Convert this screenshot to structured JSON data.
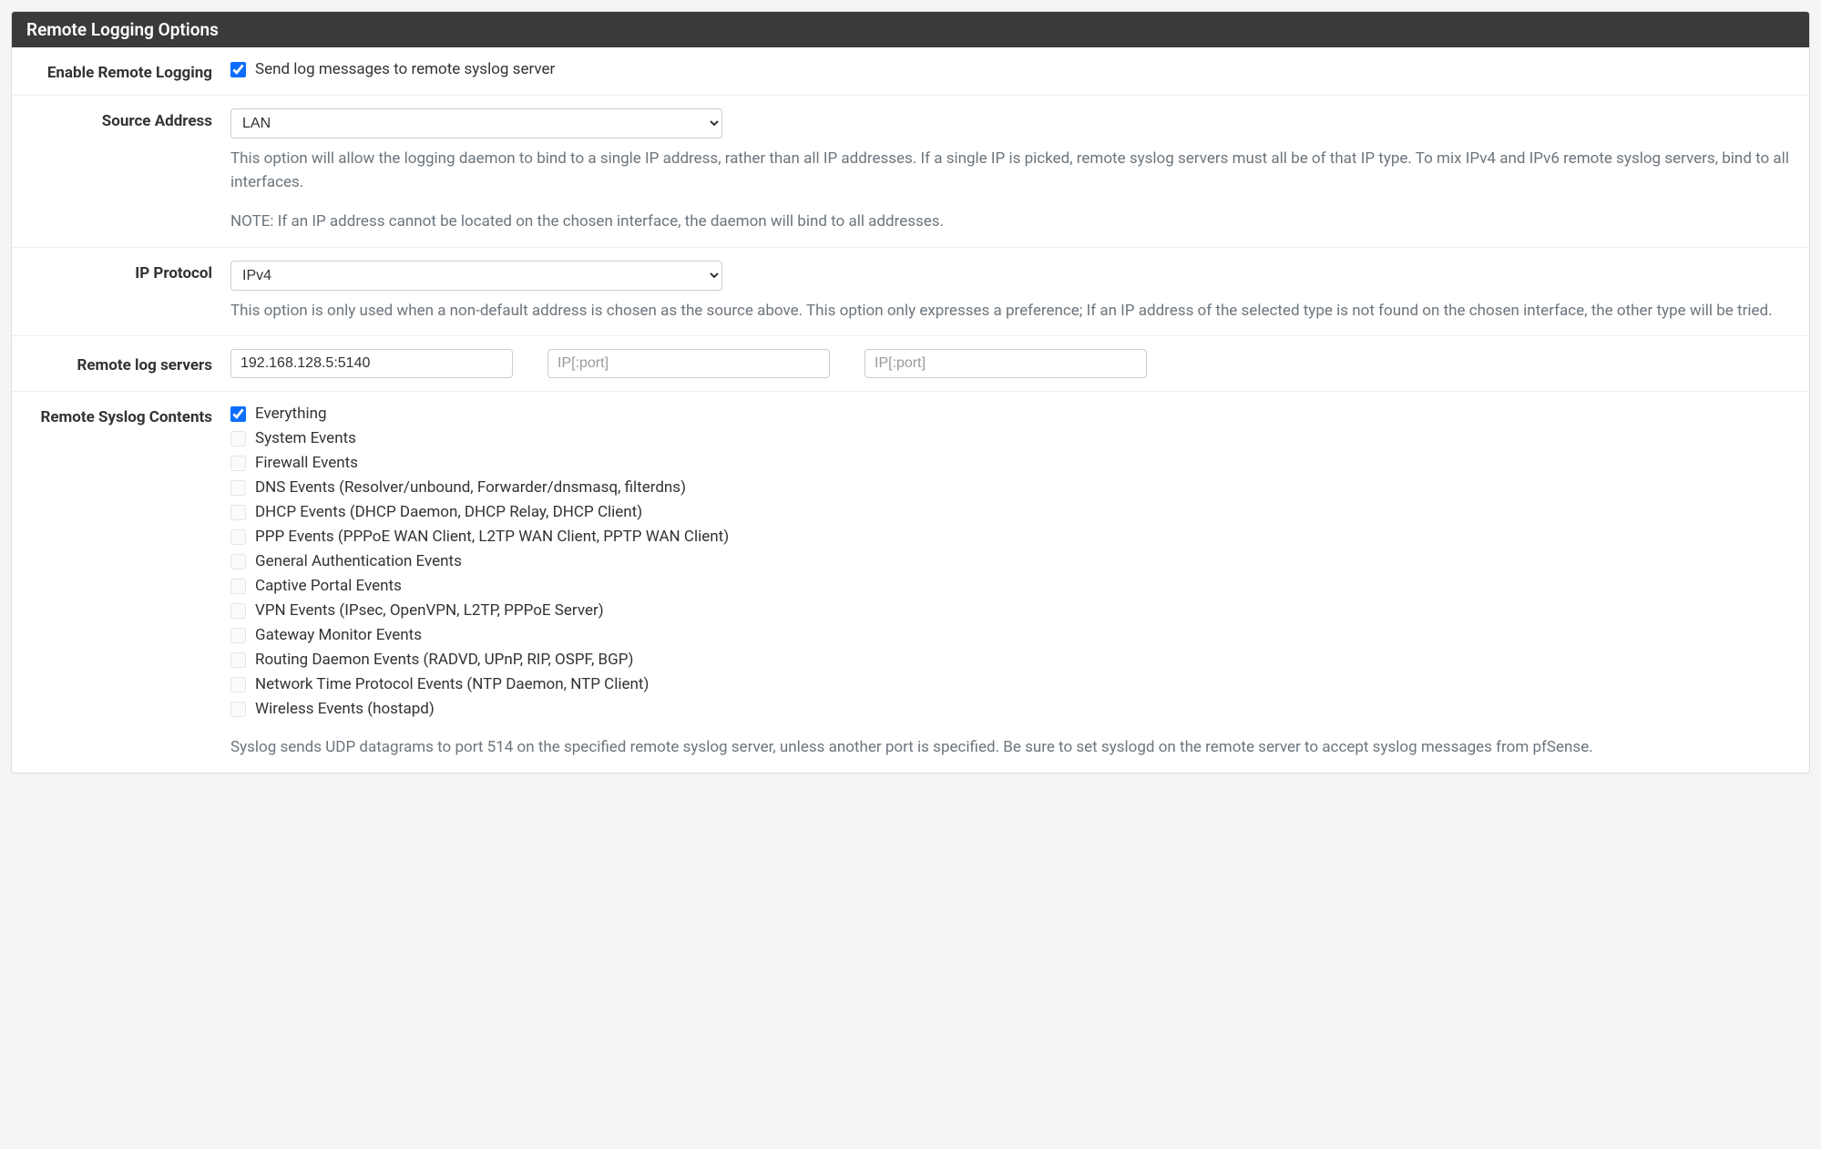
{
  "panel": {
    "title": "Remote Logging Options"
  },
  "enableRemote": {
    "label": "Enable Remote Logging",
    "checkboxLabel": "Send log messages to remote syslog server",
    "checked": true
  },
  "sourceAddress": {
    "label": "Source Address",
    "selected": "LAN",
    "help1": "This option will allow the logging daemon to bind to a single IP address, rather than all IP addresses. If a single IP is picked, remote syslog servers must all be of that IP type. To mix IPv4 and IPv6 remote syslog servers, bind to all interfaces.",
    "help2": "NOTE: If an IP address cannot be located on the chosen interface, the daemon will bind to all addresses."
  },
  "ipProtocol": {
    "label": "IP Protocol",
    "selected": "IPv4",
    "help": "This option is only used when a non-default address is chosen as the source above. This option only expresses a preference; If an IP address of the selected type is not found on the chosen interface, the other type will be tried."
  },
  "remoteServers": {
    "label": "Remote log servers",
    "server1": "192.168.128.5:5140",
    "server2": "",
    "server3": "",
    "placeholder": "IP[:port]"
  },
  "syslogContents": {
    "label": "Remote Syslog Contents",
    "items": [
      {
        "label": "Everything",
        "checked": true,
        "disabled": false
      },
      {
        "label": "System Events",
        "checked": false,
        "disabled": true
      },
      {
        "label": "Firewall Events",
        "checked": false,
        "disabled": true
      },
      {
        "label": "DNS Events (Resolver/unbound, Forwarder/dnsmasq, filterdns)",
        "checked": false,
        "disabled": true
      },
      {
        "label": "DHCP Events (DHCP Daemon, DHCP Relay, DHCP Client)",
        "checked": false,
        "disabled": true
      },
      {
        "label": "PPP Events (PPPoE WAN Client, L2TP WAN Client, PPTP WAN Client)",
        "checked": false,
        "disabled": true
      },
      {
        "label": "General Authentication Events",
        "checked": false,
        "disabled": true
      },
      {
        "label": "Captive Portal Events",
        "checked": false,
        "disabled": true
      },
      {
        "label": "VPN Events (IPsec, OpenVPN, L2TP, PPPoE Server)",
        "checked": false,
        "disabled": true
      },
      {
        "label": "Gateway Monitor Events",
        "checked": false,
        "disabled": true
      },
      {
        "label": "Routing Daemon Events (RADVD, UPnP, RIP, OSPF, BGP)",
        "checked": false,
        "disabled": true
      },
      {
        "label": "Network Time Protocol Events (NTP Daemon, NTP Client)",
        "checked": false,
        "disabled": true
      },
      {
        "label": "Wireless Events (hostapd)",
        "checked": false,
        "disabled": true
      }
    ],
    "help": "Syslog sends UDP datagrams to port 514 on the specified remote syslog server, unless another port is specified. Be sure to set syslogd on the remote server to accept syslog messages from pfSense."
  }
}
